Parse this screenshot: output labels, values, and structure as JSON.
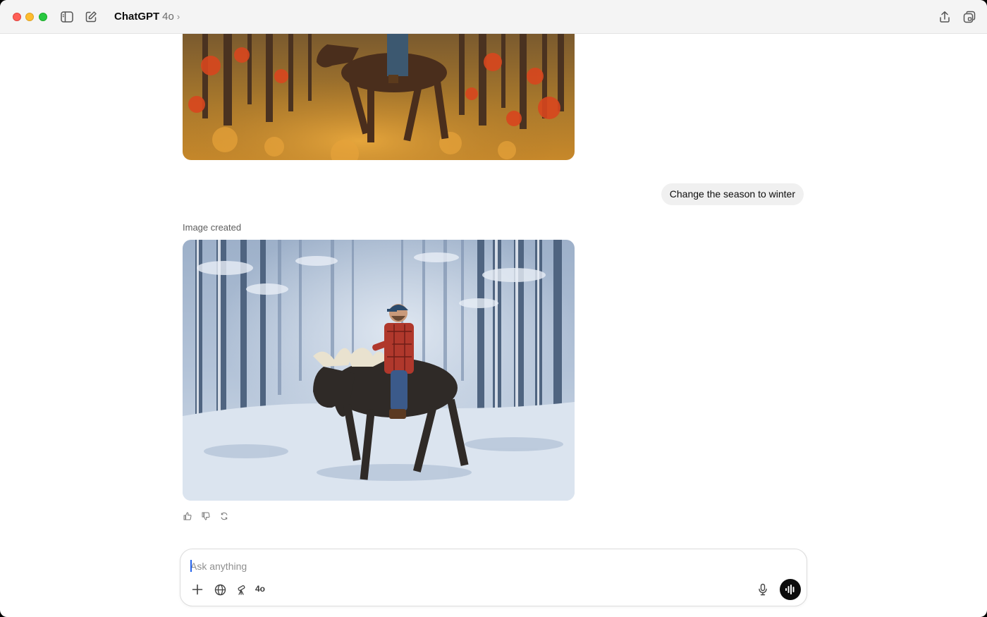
{
  "window": {
    "title": "ChatGPT",
    "model": "4o",
    "chevron": "›"
  },
  "icons": {
    "sidebar": "sidebar-toggle-icon",
    "new_chat": "compose-icon",
    "share": "share-icon",
    "new_window": "new-window-icon",
    "thumbs_up": "thumbs-up-icon",
    "thumbs_down": "thumbs-down-icon",
    "regenerate": "regenerate-icon",
    "attach": "plus-icon",
    "search": "globe-icon",
    "tools": "telescope-icon",
    "mic": "microphone-icon",
    "voice": "voice-waveform-icon"
  },
  "conversation": {
    "user_message": "Change the season to winter",
    "assistant_status": "Image created"
  },
  "composer": {
    "placeholder": "Ask anything",
    "value": "",
    "model_label": "4o"
  },
  "colors": {
    "close": "#ff5f57",
    "minimize": "#febc2e",
    "zoom": "#28c840",
    "bubble": "#f0f0f0",
    "voice_button": "#0d0d0d"
  }
}
